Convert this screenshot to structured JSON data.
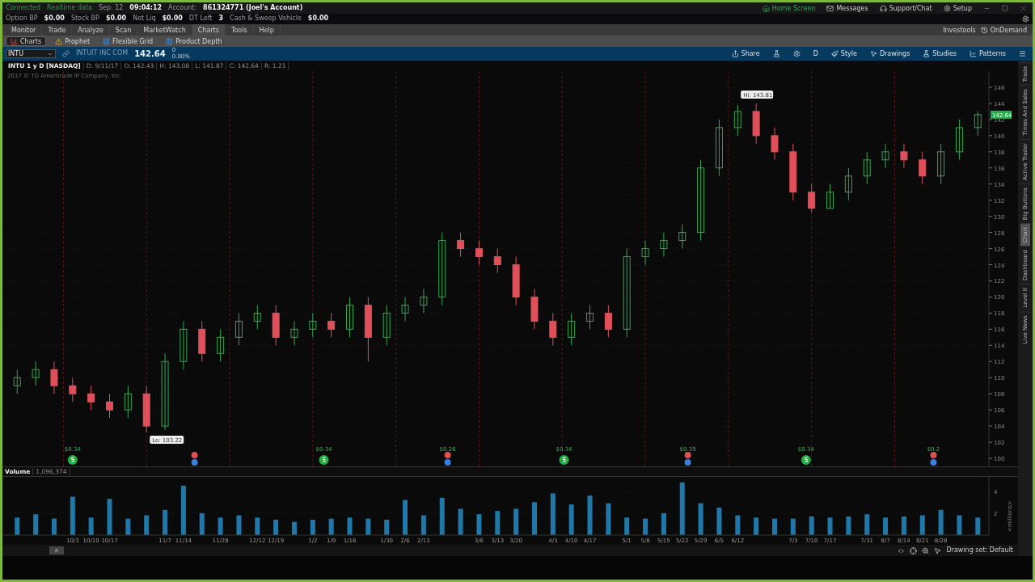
{
  "status_top": {
    "connection": "Connected",
    "data_feed": "Realtime data",
    "date": "Sep. 12",
    "time": "09:04:12",
    "account_label": "Account:",
    "account": "861324771 (Joel's Account)"
  },
  "header_links": [
    {
      "kind": "home",
      "label": "Home Screen"
    },
    {
      "kind": "mail",
      "label": "Messages"
    },
    {
      "kind": "support",
      "label": "Support/Chat"
    },
    {
      "kind": "setup",
      "label": "Setup"
    }
  ],
  "balances": [
    {
      "label": "Option BP",
      "value": "$0.00"
    },
    {
      "label": "Stock BP",
      "value": "$0.00"
    },
    {
      "label": "Net Liq",
      "value": "$0.00"
    },
    {
      "label": "DT Left",
      "value": "3"
    },
    {
      "label": "Cash & Sweep Vehicle",
      "value": "$0.00"
    }
  ],
  "main_tabs": [
    {
      "label": "Monitor",
      "selected": false
    },
    {
      "label": "Trade",
      "selected": false
    },
    {
      "label": "Analyze",
      "selected": false
    },
    {
      "label": "Scan",
      "selected": false
    },
    {
      "label": "MarketWatch",
      "selected": false
    },
    {
      "label": "Charts",
      "selected": true
    },
    {
      "label": "Tools",
      "selected": false
    },
    {
      "label": "Help",
      "selected": false
    }
  ],
  "right_links": [
    {
      "kind": "plain",
      "label": "Investools"
    },
    {
      "kind": "ondemand",
      "label": "OnDemand"
    }
  ],
  "sub_tabs": [
    {
      "kind": "charts",
      "label": "Charts",
      "selected": true
    },
    {
      "kind": "prophet",
      "label": "Prophet",
      "selected": false
    },
    {
      "kind": "grid",
      "label": "Flexible Grid",
      "selected": false
    },
    {
      "kind": "depth",
      "label": "Product Depth",
      "selected": false
    }
  ],
  "symbol_bar": {
    "symbol": "INTU",
    "description": "INTUIT INC COM",
    "last": "142.64",
    "change": "0",
    "change_pct": "0.00%"
  },
  "chart_tools": [
    {
      "kind": "share",
      "label": "Share"
    },
    {
      "kind": "flask"
    },
    {
      "kind": "gear"
    },
    {
      "kind": "aggregation",
      "label": "D"
    },
    {
      "kind": "style",
      "label": "Style"
    },
    {
      "kind": "drawings",
      "label": "Drawings"
    },
    {
      "kind": "studies",
      "label": "Studies"
    },
    {
      "kind": "patterns",
      "label": "Patterns"
    },
    {
      "kind": "menu"
    }
  ],
  "info_bar": {
    "title": "INTU 1 y D [NASDAQ]",
    "fields": [
      "D: 9/11/17",
      "O: 142.43",
      "H: 143.08",
      "L: 141.87",
      "C: 142.64",
      "R: 1.21"
    ]
  },
  "price_chart": {
    "copyright": "2017 © TD Ameritrade IP Company, Inc.",
    "high_label": "Hi: 143.81",
    "low_label": "Lo: 103.22",
    "last_badge": "142.64",
    "events": [
      {
        "kind": "dividend",
        "label": "$0.34"
      },
      {
        "kind": "earnings"
      },
      {
        "kind": "dividend",
        "label": "$0.34"
      },
      {
        "kind": "earnings",
        "label": "$0.26"
      },
      {
        "kind": "dividend",
        "label": "$0.34"
      },
      {
        "kind": "earnings",
        "label": "$0.39"
      },
      {
        "kind": "dividend",
        "label": "$0.34"
      },
      {
        "kind": "earnings",
        "label": "$0.2"
      }
    ],
    "chart_data": {
      "type": "candlestick",
      "grid": true,
      "ylim": [
        99,
        148
      ],
      "yticks": [
        100,
        102,
        104,
        106,
        108,
        110,
        112,
        114,
        116,
        118,
        120,
        122,
        124,
        126,
        128,
        130,
        132,
        134,
        136,
        138,
        140,
        142,
        144,
        146
      ],
      "ohlc": [
        [
          109,
          111,
          108,
          110
        ],
        [
          110,
          112,
          109,
          111
        ],
        [
          111,
          112,
          108,
          109
        ],
        [
          109,
          110,
          107,
          108
        ],
        [
          108,
          109,
          106,
          107
        ],
        [
          107,
          108,
          105,
          106
        ],
        [
          106,
          109,
          105,
          108
        ],
        [
          108,
          109,
          103.2,
          104
        ],
        [
          104,
          113,
          103.5,
          112
        ],
        [
          112,
          117,
          111,
          116
        ],
        [
          116,
          117,
          112,
          113
        ],
        [
          113,
          116,
          112,
          115
        ],
        [
          115,
          118,
          114,
          117
        ],
        [
          117,
          119,
          116,
          118
        ],
        [
          118,
          119,
          114,
          115
        ],
        [
          115,
          117,
          114,
          116
        ],
        [
          116,
          118,
          115,
          117
        ],
        [
          117,
          118,
          115,
          116
        ],
        [
          116,
          120,
          115,
          119
        ],
        [
          119,
          120,
          112,
          115
        ],
        [
          115,
          119,
          114,
          118
        ],
        [
          118,
          120,
          117,
          119
        ],
        [
          119,
          121,
          118,
          120
        ],
        [
          120,
          128,
          119,
          127
        ],
        [
          127,
          128,
          125,
          126
        ],
        [
          126,
          127,
          124,
          125
        ],
        [
          125,
          126,
          123,
          124
        ],
        [
          124,
          125,
          119,
          120
        ],
        [
          120,
          121,
          116,
          117
        ],
        [
          117,
          118,
          114,
          115
        ],
        [
          115,
          118,
          114,
          117
        ],
        [
          117,
          119,
          116,
          118
        ],
        [
          118,
          119,
          115,
          116
        ],
        [
          116,
          126,
          115,
          125
        ],
        [
          125,
          127,
          124,
          126
        ],
        [
          126,
          128,
          125,
          127
        ],
        [
          127,
          129,
          126,
          128
        ],
        [
          128,
          137,
          127,
          136
        ],
        [
          136,
          142,
          135,
          141
        ],
        [
          141,
          143.8,
          140,
          143
        ],
        [
          143,
          144,
          139,
          140
        ],
        [
          140,
          141,
          137,
          138
        ],
        [
          138,
          139,
          132,
          133
        ],
        [
          133,
          134,
          130.5,
          131
        ],
        [
          131,
          134,
          131,
          133
        ],
        [
          133,
          136,
          132,
          135
        ],
        [
          135,
          138,
          134,
          137
        ],
        [
          137,
          139,
          136,
          138
        ],
        [
          138,
          139,
          136,
          137
        ],
        [
          137,
          138,
          134,
          135
        ],
        [
          135,
          139,
          134,
          138
        ],
        [
          138,
          142,
          137,
          141
        ],
        [
          141,
          143,
          140,
          142.6
        ]
      ]
    }
  },
  "volume_chart": {
    "reading": "1,096,374",
    "chart_data": {
      "type": "bar",
      "ylabel": "<millions>",
      "ylim": [
        0,
        5.3
      ],
      "yticks": [
        2,
        4
      ],
      "categories": [
        null,
        null,
        null,
        "10/3",
        "10/10",
        "10/17",
        null,
        null,
        "11/7",
        "11/14",
        null,
        "11/28",
        null,
        "12/12",
        "12/19",
        null,
        "1/2",
        "1/9",
        "1/16",
        null,
        "1/30",
        "2/6",
        "2/13",
        null,
        null,
        "3/6",
        "3/13",
        "3/20",
        null,
        "4/3",
        "4/10",
        "4/17",
        null,
        "5/1",
        "5/8",
        "5/15",
        "5/22",
        "5/29",
        "6/5",
        "6/12",
        null,
        null,
        "7/3",
        "7/10",
        "7/17",
        null,
        "7/31",
        "8/7",
        "8/14",
        "8/21",
        "8/28",
        null,
        null
      ],
      "series": [
        {
          "name": "Volume",
          "color": "#1f78a8",
          "values": [
            1.6,
            1.9,
            1.5,
            3.5,
            1.6,
            3.3,
            1.5,
            1.8,
            2.3,
            4.5,
            2.0,
            1.6,
            1.8,
            1.6,
            1.4,
            1.2,
            1.4,
            1.5,
            1.6,
            1.5,
            1.4,
            3.2,
            1.8,
            3.4,
            2.4,
            1.9,
            2.2,
            2.4,
            3.0,
            3.8,
            2.8,
            3.6,
            2.9,
            1.6,
            1.5,
            2.0,
            4.8,
            2.9,
            2.5,
            1.8,
            1.6,
            1.5,
            1.5,
            1.7,
            1.6,
            1.7,
            1.9,
            1.6,
            1.7,
            1.8,
            2.3,
            1.8,
            1.6
          ]
        }
      ]
    }
  },
  "bottom_bar": {
    "drawing_set": "Drawing set: Default"
  },
  "side_tabs": [
    {
      "label": "Trade",
      "selected": false
    },
    {
      "label": "Times And Sales",
      "selected": false
    },
    {
      "label": "Active Trader",
      "selected": false
    },
    {
      "label": "Big Buttons",
      "selected": false
    },
    {
      "label": "Chart",
      "selected": true
    },
    {
      "label": "Dashboard",
      "selected": false
    },
    {
      "label": "Level II",
      "selected": false
    },
    {
      "label": "Live News",
      "selected": false
    }
  ]
}
